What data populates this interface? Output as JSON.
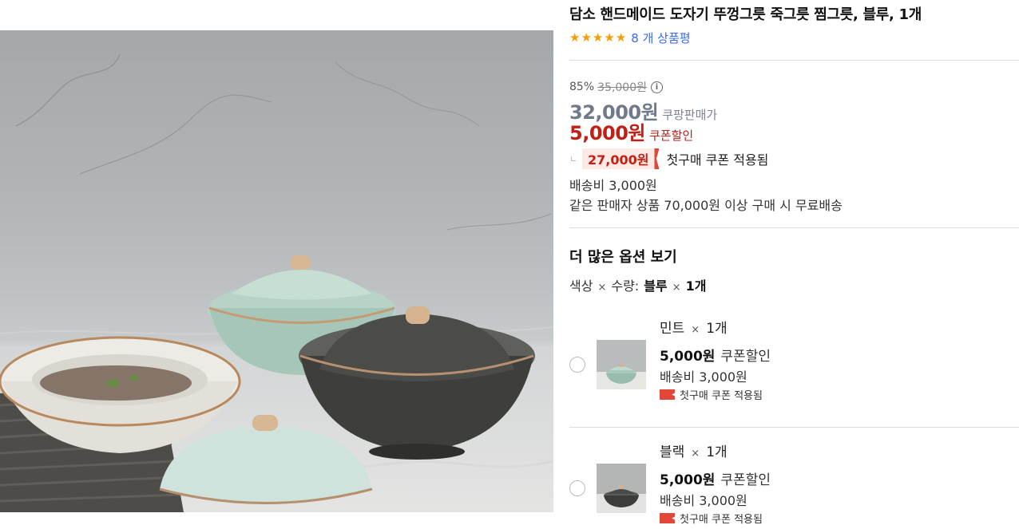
{
  "product": {
    "title": "담소 핸드메이드 도자기 뚜껑그릇 죽그릇 찜그릇, 블루, 1개",
    "rating_stars": 5,
    "review_link": "8 개 상품평",
    "star_color": "#f59c00",
    "link_color": "#346aff"
  },
  "price": {
    "discount_rate": "85%",
    "original_price": "35,000원",
    "info_icon": "i",
    "sale_price": "32,000원",
    "sale_label": "쿠팡판매가",
    "coupon_price": "5,000원",
    "coupon_label": "쿠폰할인",
    "first_purchase_price": "27,000원",
    "first_purchase_label": "첫구매 쿠폰 적용됨",
    "accent_color": "#c31f12"
  },
  "shipping": {
    "fee": "배송비 3,000원",
    "condition": "같은 판매자 상품 70,000원 이상 구매 시 무료배송"
  },
  "options": {
    "section_title": "더 많은 옵션 보기",
    "selected_prefix": "색상",
    "selected_mid": "수량:",
    "selected_value": "블루",
    "selected_qty": "1개",
    "times": "×",
    "items": [
      {
        "name": "민트",
        "times": "×",
        "qty": "1개",
        "price": "5,000원",
        "price_label": "쿠폰할인",
        "shipping": "배송비 3,000원",
        "first_label": "첫구매 쿠폰 적용됨",
        "thumb_icon": "mint-bowl-icon"
      },
      {
        "name": "블랙",
        "times": "×",
        "qty": "1개",
        "price": "5,000원",
        "price_label": "쿠폰할인",
        "shipping": "배송비 3,000원",
        "first_label": "첫구매 쿠폰 적용됨",
        "thumb_icon": "black-bowl-icon"
      }
    ]
  }
}
